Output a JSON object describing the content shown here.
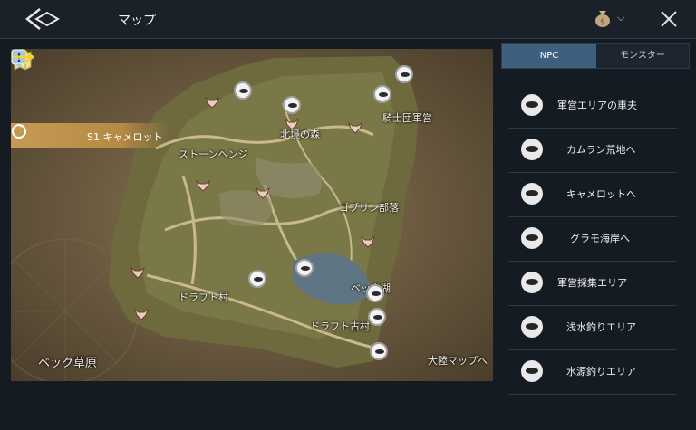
{
  "header": {
    "title": "マップ",
    "back_icon": "back-arrow-icon",
    "currency_icon": "money-bag-icon",
    "close_icon": "close-icon"
  },
  "map": {
    "region_label": "S1 キャメロット",
    "region_icon": "refresh-cycle-icon",
    "labels": {
      "north_forest": "北境の森",
      "knights_camp": "騎士団軍営",
      "stonehenge": "ストーンヘンジ",
      "goblin_tribe": "ゴブリン部落",
      "lake": "ベック湖",
      "draft_village": "ドラフト村",
      "draft_old_village": "ドラフト古村",
      "bec_plains": "ベック草原",
      "continent_map": "大陸マップへ"
    },
    "player_marker": "player-arrow-icon",
    "quest_marker": "quest-exclamation-icon"
  },
  "panel": {
    "tabs": [
      {
        "label": "NPC",
        "active": true
      },
      {
        "label": "モンスター",
        "active": false
      }
    ],
    "items": [
      {
        "label": "軍営エリアの車夫",
        "icon": "carriage-icon"
      },
      {
        "label": "カムラン荒地へ",
        "icon": "gate-icon"
      },
      {
        "label": "キャメロットへ",
        "icon": "gate-icon"
      },
      {
        "label": "グラモ海岸へ",
        "icon": "gate-icon"
      },
      {
        "label": "軍営採集エリア",
        "icon": "gather-icon"
      },
      {
        "label": "浅水釣りエリア",
        "icon": "fishing-icon"
      },
      {
        "label": "水源釣りエリア",
        "icon": "fishing-icon"
      }
    ]
  }
}
